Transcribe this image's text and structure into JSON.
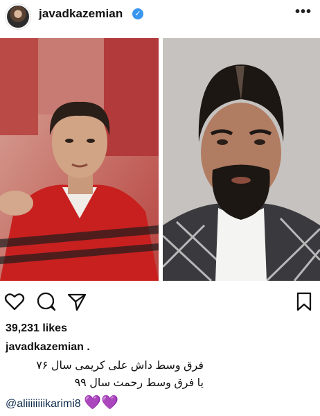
{
  "header": {
    "username": "javadkazemian",
    "verified_mark": "✓",
    "more_icon": "•••"
  },
  "post": {
    "left_photo_desc": "vintage red jersey player",
    "right_photo_desc": "bearded man in checked suit"
  },
  "actions": {
    "like_icon": "heart-icon",
    "comment_icon": "comment-icon",
    "share_icon": "share-icon",
    "save_icon": "bookmark-icon"
  },
  "stats": {
    "likes": "39,231 likes"
  },
  "caption": {
    "username": "javadkazemian .",
    "line1": "فرق وسط داش علی کریمی سال ۷۶",
    "line2": "یا فرق وسط رحمت سال ۹۹",
    "mention": "@aliiiiiiiikarimi8",
    "hearts": "💜💜"
  },
  "colors": {
    "verified": "#3897f0",
    "heart_emoji": "#9b3fd6"
  }
}
